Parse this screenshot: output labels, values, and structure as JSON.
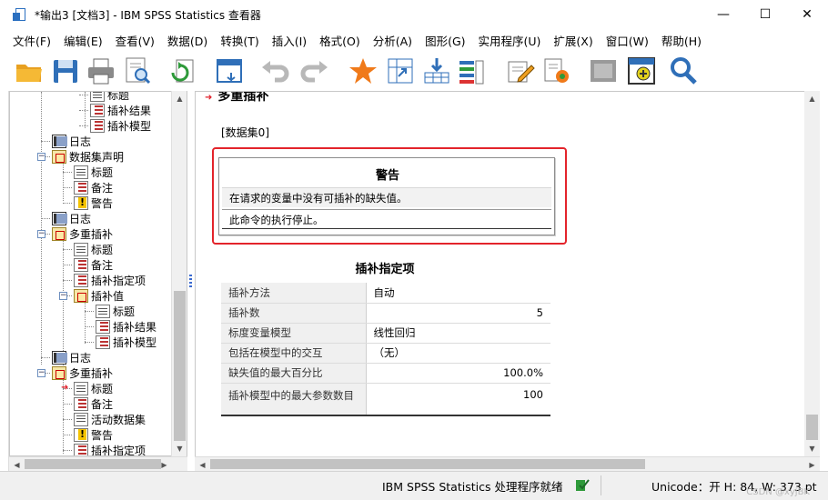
{
  "window": {
    "title": "*输出3 [文档3] - IBM SPSS Statistics 查看器",
    "minimize": "—",
    "maximize": "☐",
    "close": "✕"
  },
  "menu": [
    "文件(F)",
    "编辑(E)",
    "查看(V)",
    "数据(D)",
    "转换(T)",
    "插入(I)",
    "格式(O)",
    "分析(A)",
    "图形(G)",
    "实用程序(U)",
    "扩展(X)",
    "窗口(W)",
    "帮助(H)"
  ],
  "toolbar": {
    "icons": [
      "open-folder-icon",
      "save-icon",
      "print-icon",
      "print-preview-icon",
      "export-icon",
      "recall-dialog-icon",
      "undo-icon",
      "redo-icon",
      "goto-data-icon",
      "goto-case-icon",
      "goto-variable-icon",
      "variables-icon",
      "designated-window-icon",
      "edit-icon",
      "show-all-icon",
      "hide-icon",
      "insert-icon",
      "find-icon"
    ]
  },
  "outline": {
    "items": [
      {
        "label": "标题",
        "icon": "doc"
      },
      {
        "label": "插补结果",
        "icon": "table"
      },
      {
        "label": "插补模型",
        "icon": "table"
      },
      {
        "label": "日志",
        "icon": "log"
      },
      {
        "label": "数据集声明",
        "icon": "folder"
      },
      {
        "label": "标题",
        "icon": "doc"
      },
      {
        "label": "备注",
        "icon": "table"
      },
      {
        "label": "警告",
        "icon": "warn"
      },
      {
        "label": "日志",
        "icon": "log"
      },
      {
        "label": "多重插补",
        "icon": "folder"
      },
      {
        "label": "标题",
        "icon": "doc"
      },
      {
        "label": "备注",
        "icon": "table"
      },
      {
        "label": "插补指定项",
        "icon": "table"
      },
      {
        "label": "插补值",
        "icon": "folder"
      },
      {
        "label": "标题",
        "icon": "doc"
      },
      {
        "label": "插补结果",
        "icon": "table"
      },
      {
        "label": "插补模型",
        "icon": "table"
      },
      {
        "label": "日志",
        "icon": "log"
      },
      {
        "label": "多重插补",
        "icon": "folder"
      },
      {
        "label": "标题",
        "icon": "doc"
      },
      {
        "label": "备注",
        "icon": "table"
      },
      {
        "label": "活动数据集",
        "icon": "ds"
      },
      {
        "label": "警告",
        "icon": "warn"
      },
      {
        "label": "插补指定项",
        "icon": "table"
      }
    ]
  },
  "content": {
    "cut_heading": "多重插补",
    "dataset": "[数据集0]",
    "warning": {
      "title": "警告",
      "lines": [
        "在请求的变量中没有可插补的缺失值。",
        "此命令的执行停止。"
      ]
    },
    "spec": {
      "title": "插补指定项",
      "rows": [
        {
          "label": "插补方法",
          "value": "自动",
          "align": "left"
        },
        {
          "label": "插补数",
          "value": "5",
          "align": "right"
        },
        {
          "label": "标度变量模型",
          "value": "线性回归",
          "align": "left"
        },
        {
          "label": "包括在模型中的交互",
          "value": "（无）",
          "align": "left"
        },
        {
          "label": "缺失值的最大百分比",
          "value": "100.0%",
          "align": "right"
        },
        {
          "label": "插补模型中的最大参数数目",
          "value": "100",
          "align": "right"
        }
      ]
    }
  },
  "status": {
    "processor": "IBM SPSS Statistics 处理程序就绪",
    "encoding": "Unicode：开  H: 84, W: 373 pt",
    "watermark": "CSDN @xyjBK"
  }
}
